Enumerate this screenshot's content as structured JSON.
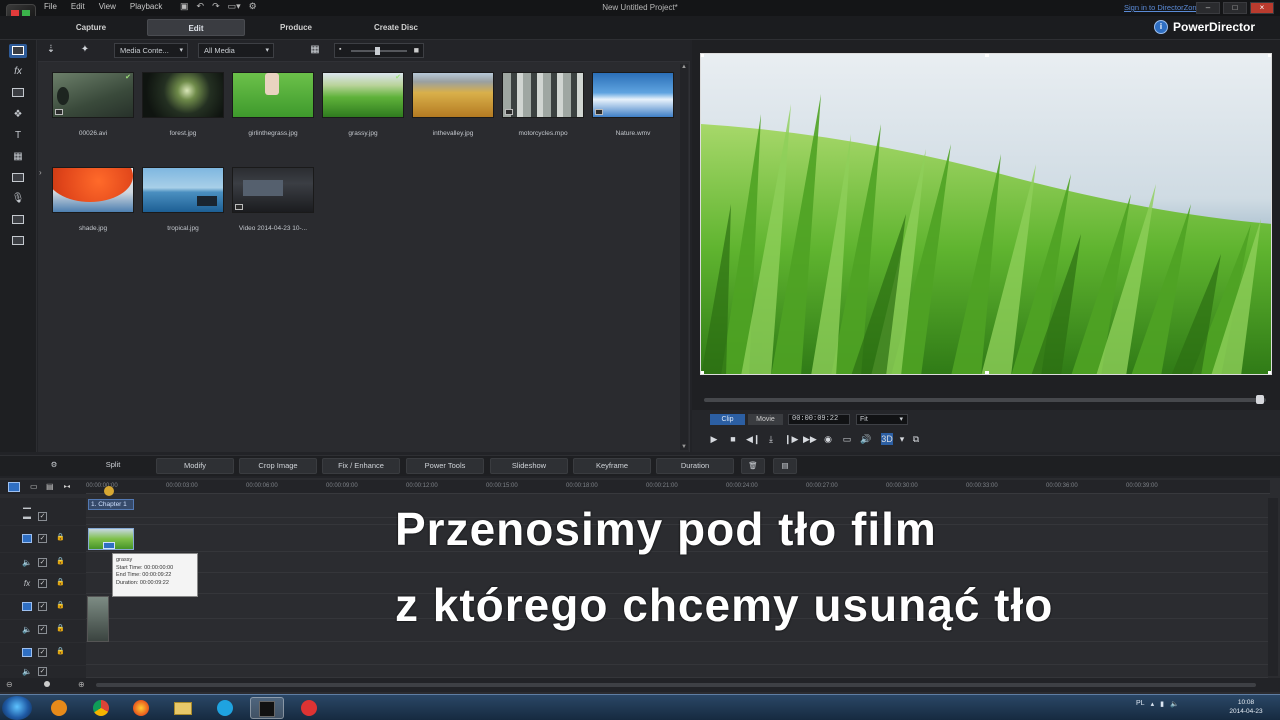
{
  "window": {
    "menu": [
      "File",
      "Edit",
      "View",
      "Playback"
    ],
    "project_title": "New Untitled Project*",
    "sign_in": "Sign in to DirectorZone",
    "brand": "PowerDirector"
  },
  "modes": [
    {
      "label": "Capture",
      "active": false
    },
    {
      "label": "Edit",
      "active": true
    },
    {
      "label": "Produce",
      "active": false
    },
    {
      "label": "Create Disc",
      "active": false
    }
  ],
  "library": {
    "content_dropdown": "Media Conte...",
    "filter_dropdown": "All Media",
    "items": [
      {
        "name": "00026.avi",
        "kind": "video",
        "checked": true
      },
      {
        "name": "forest.jpg",
        "kind": "image",
        "checked": false
      },
      {
        "name": "girlinthegrass.jpg",
        "kind": "image",
        "checked": false
      },
      {
        "name": "grassy.jpg",
        "kind": "image",
        "checked": true
      },
      {
        "name": "inthevalley.jpg",
        "kind": "image",
        "checked": false
      },
      {
        "name": "motorcycles.mpo",
        "kind": "image",
        "checked": false
      },
      {
        "name": "Nature.wmv",
        "kind": "video",
        "checked": false
      },
      {
        "name": "shade.jpg",
        "kind": "image",
        "checked": false
      },
      {
        "name": "tropical.jpg",
        "kind": "image",
        "checked": false
      },
      {
        "name": "Video 2014-04-23 10-...",
        "kind": "video",
        "checked": false
      }
    ]
  },
  "preview": {
    "clip_label": "Clip",
    "movie_label": "Movie",
    "timecode": "00:00:09:22",
    "fit": "Fit",
    "progress": 1.0
  },
  "edit_toolbar": [
    "Split",
    "Modify",
    "Crop Image",
    "Fix / Enhance",
    "Power Tools",
    "Slideshow",
    "Keyframe",
    "Duration"
  ],
  "timeline": {
    "ruler": [
      "00:00:00:00",
      "00:00:03:00",
      "00:00:06:00",
      "00:00:09:00",
      "00:00:12:00",
      "00:00:15:00",
      "00:00:18:00",
      "00:00:21:00",
      "00:00:24:00",
      "00:00:27:00",
      "00:00:30:00",
      "00:00:33:00",
      "00:00:36:00",
      "00:00:39:00"
    ],
    "chapter": "1. Chapter 1",
    "tooltip": {
      "name": "grassy",
      "start": "Start Time: 00:00:00:00",
      "end": "End Time: 00:00:09:22",
      "duration": "Duration: 00:00:09:22"
    }
  },
  "overlay": {
    "line1": "Przenosimy pod tło film",
    "line2": "z którego chcemy usunąć tło"
  },
  "taskbar": {
    "lang": "PL",
    "time": "10:08",
    "date": "2014-04-23"
  },
  "colors": {
    "accent": "#2f6fc3",
    "playhead": "#d7a833"
  }
}
